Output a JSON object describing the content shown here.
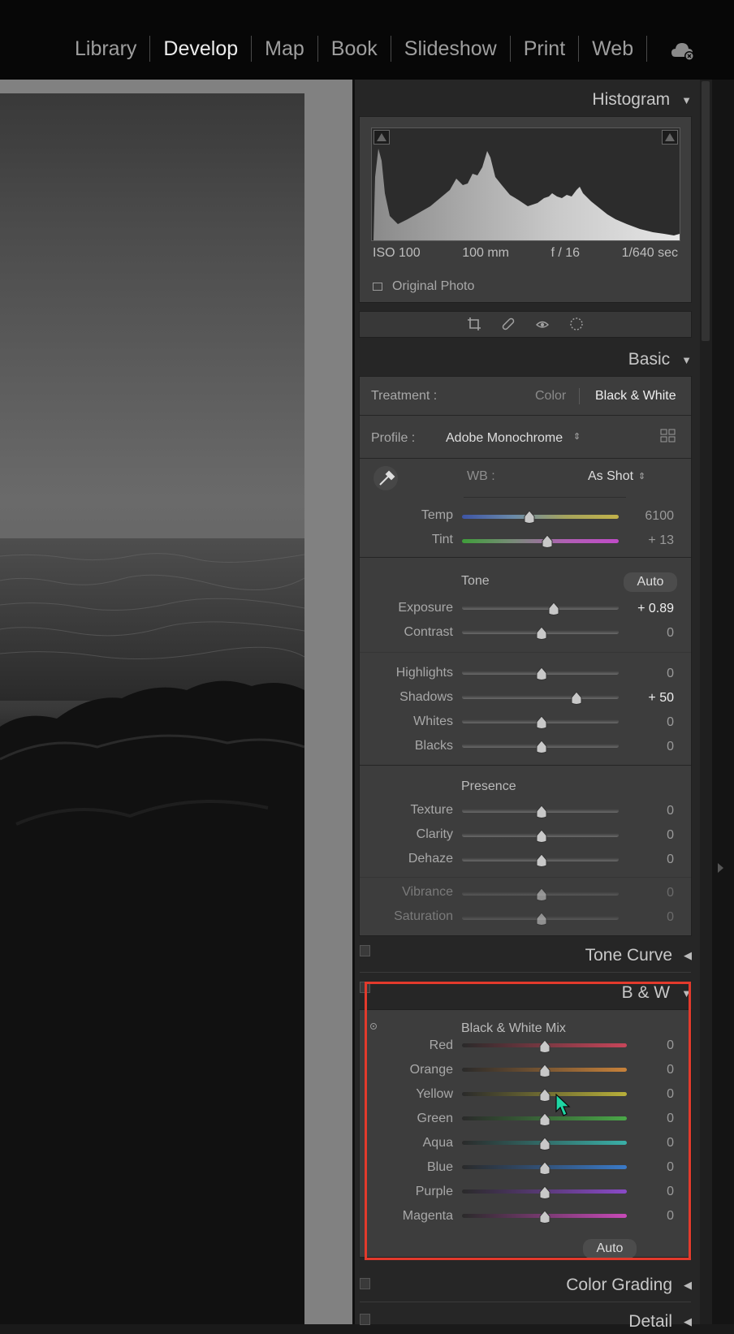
{
  "modules": [
    "Library",
    "Develop",
    "Map",
    "Book",
    "Slideshow",
    "Print",
    "Web"
  ],
  "active_module": "Develop",
  "histogram": {
    "title": "Histogram",
    "iso": "ISO 100",
    "focal": "100 mm",
    "aperture": "f / 16",
    "shutter": "1/640 sec",
    "original_photo": "Original Photo"
  },
  "basic": {
    "title": "Basic",
    "treatment_label": "Treatment :",
    "treatment_color": "Color",
    "treatment_bw": "Black & White",
    "profile_label": "Profile :",
    "profile_value": "Adobe Monochrome",
    "wb_label": "WB :",
    "wb_value": "As Shot",
    "temp_label": "Temp",
    "temp_value": "6100",
    "tint_label": "Tint",
    "tint_value": "+ 13",
    "tone_label": "Tone",
    "auto_label": "Auto",
    "exposure_label": "Exposure",
    "exposure_value": "+ 0.89",
    "contrast_label": "Contrast",
    "contrast_value": "0",
    "highlights_label": "Highlights",
    "highlights_value": "0",
    "shadows_label": "Shadows",
    "shadows_value": "+ 50",
    "whites_label": "Whites",
    "whites_value": "0",
    "blacks_label": "Blacks",
    "blacks_value": "0",
    "presence_label": "Presence",
    "texture_label": "Texture",
    "texture_value": "0",
    "clarity_label": "Clarity",
    "clarity_value": "0",
    "dehaze_label": "Dehaze",
    "dehaze_value": "0",
    "vibrance_label": "Vibrance",
    "vibrance_value": "0",
    "saturation_label": "Saturation",
    "saturation_value": "0"
  },
  "panels": {
    "tone_curve": "Tone Curve",
    "bw": "B & W",
    "color_grading": "Color Grading",
    "detail": "Detail"
  },
  "bw_mix": {
    "title": "Black & White Mix",
    "auto": "Auto",
    "channels": [
      {
        "name": "Red",
        "value": "0"
      },
      {
        "name": "Orange",
        "value": "0"
      },
      {
        "name": "Yellow",
        "value": "0"
      },
      {
        "name": "Green",
        "value": "0"
      },
      {
        "name": "Aqua",
        "value": "0"
      },
      {
        "name": "Blue",
        "value": "0"
      },
      {
        "name": "Purple",
        "value": "0"
      },
      {
        "name": "Magenta",
        "value": "0"
      }
    ]
  },
  "colors": {
    "highlight_box": "#e33a2c",
    "cursor": "#1fd6a4"
  }
}
